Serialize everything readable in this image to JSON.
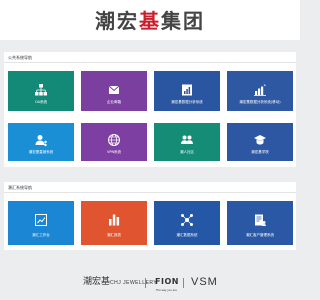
{
  "header": {
    "logo_text": "潮宏",
    "logo_mark": "基",
    "logo_text_end": "集团"
  },
  "sections": [
    {
      "title": "公共系统导航",
      "tiles": [
        {
          "label": "OA系统",
          "color": "#138a78",
          "icon": "org-chart-icon"
        },
        {
          "label": "企业邮箱",
          "color": "#7b3fa0",
          "icon": "mail-icon"
        },
        {
          "label": "潮宏基数据分析系统",
          "color": "#2a55a0",
          "icon": "report-icon"
        },
        {
          "label": "潮宏基数据分析系统(移动)",
          "color": "#2f58a3",
          "icon": "bar-chart-icon"
        },
        {
          "label": "潮宏基直销系统",
          "color": "#1a8fd6",
          "icon": "user-network-icon"
        },
        {
          "label": "VPN系统",
          "color": "#7e3fa2",
          "icon": "globe-icon"
        },
        {
          "label": "潮人社区",
          "color": "#148c76",
          "icon": "people-icon"
        },
        {
          "label": "潮宏基学院",
          "color": "#2d57a3",
          "icon": "graduation-icon"
        }
      ]
    },
    {
      "title": "潮汇系统导航",
      "tiles": [
        {
          "label": "潮汇工作台",
          "color": "#1a86d4",
          "icon": "trend-chart-icon"
        },
        {
          "label": "潮汇报表",
          "color": "#e0552f",
          "icon": "column-chart-icon"
        },
        {
          "label": "潮汇数据系统",
          "color": "#2457a6",
          "icon": "network-icon"
        },
        {
          "label": "潮汇客户管理系统",
          "color": "#2a58a4",
          "icon": "document-user-icon"
        }
      ]
    }
  ],
  "footer": {
    "brands": [
      {
        "name": "潮宏基",
        "sub": "CHJ JEWELLERY"
      },
      {
        "name": "FION",
        "sub": "The way you are"
      },
      {
        "name": "VSM"
      }
    ]
  }
}
